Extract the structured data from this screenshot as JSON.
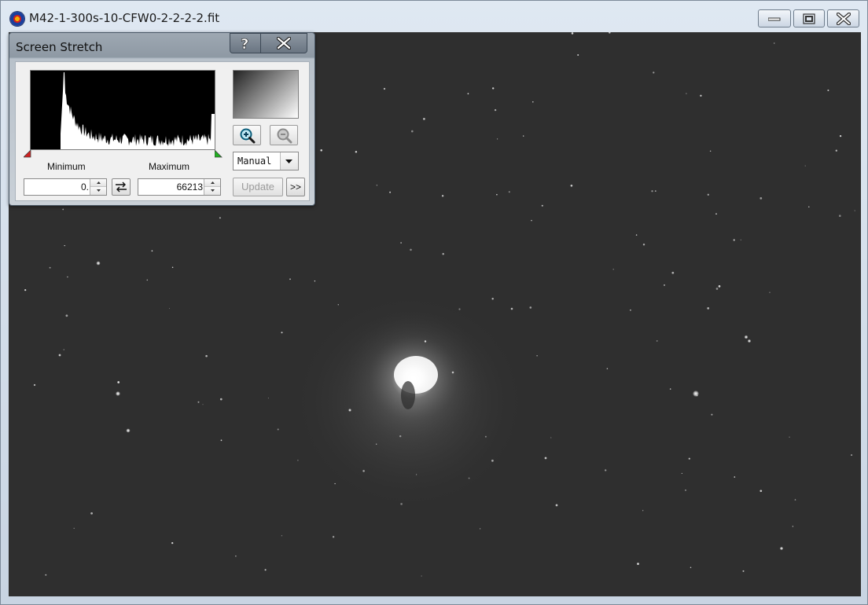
{
  "window": {
    "title": "M42-1-300s-10-CFW0-2-2-2-2.fit",
    "icon": "app-logo-icon",
    "controls": [
      "minimize-icon",
      "maximize-icon",
      "close-icon"
    ]
  },
  "screen_stretch": {
    "title": "Screen Stretch",
    "help_label": "?",
    "close_icon": "close-icon",
    "minimum_label": "Minimum",
    "maximum_label": "Maximum",
    "minimum_value": "0.",
    "maximum_value": "66213",
    "mode": "Manual",
    "update_label": "Update",
    "more_label": ">>",
    "zoom_in_icon": "zoom-in-icon",
    "zoom_out_icon": "zoom-out-icon",
    "swap_icon": "swap-arrows-icon",
    "min_marker_color": "#d02020",
    "max_marker_color": "#20b020"
  },
  "colors": {
    "image_background": "#2f2f2f",
    "histogram_background": "#000000",
    "histogram_fill": "#ffffff"
  }
}
